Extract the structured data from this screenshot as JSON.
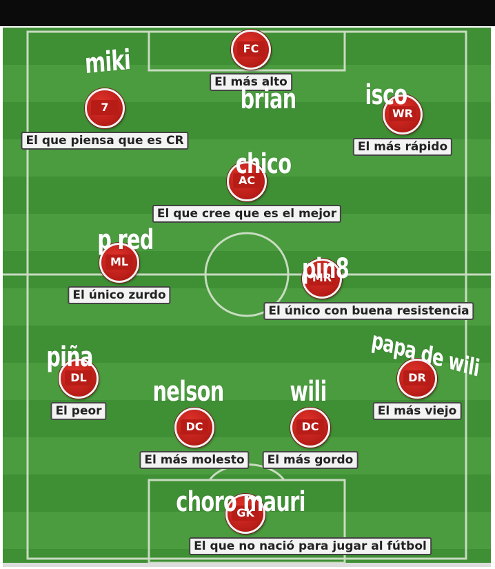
{
  "players": [
    {
      "position": "FC",
      "description": "El más alto",
      "nickname": "brian"
    },
    {
      "position": "7",
      "description": "El que piensa que es CR",
      "nickname": "miki"
    },
    {
      "position": "WR",
      "description": "El más rápido",
      "nickname": "isco"
    },
    {
      "position": "AC",
      "description": "El que cree que es el mejor",
      "nickname": "chico"
    },
    {
      "position": "ML",
      "description": "El único zurdo",
      "nickname": "p red"
    },
    {
      "position": "MR",
      "description": "El único con buena resistencia",
      "nickname": "pin8"
    },
    {
      "position": "DL",
      "description": "El peor",
      "nickname": "piña"
    },
    {
      "position": "DR",
      "description": "El más viejo",
      "nickname": "papa de wili"
    },
    {
      "position": "DC",
      "description": "El más molesto",
      "nickname": "nelson"
    },
    {
      "position": "DC",
      "description": "El más gordo",
      "nickname": "wili"
    },
    {
      "position": "GK",
      "description": "El que no nació para jugar al fútbol",
      "nickname": "choro mauri"
    }
  ],
  "colors": {
    "pitch_dark": "#3f8f35",
    "pitch_light": "#4b9b3f",
    "badge_red": "#b81c17",
    "label_bg": "#f3f3f3",
    "nickname_text": "#ffffff"
  }
}
